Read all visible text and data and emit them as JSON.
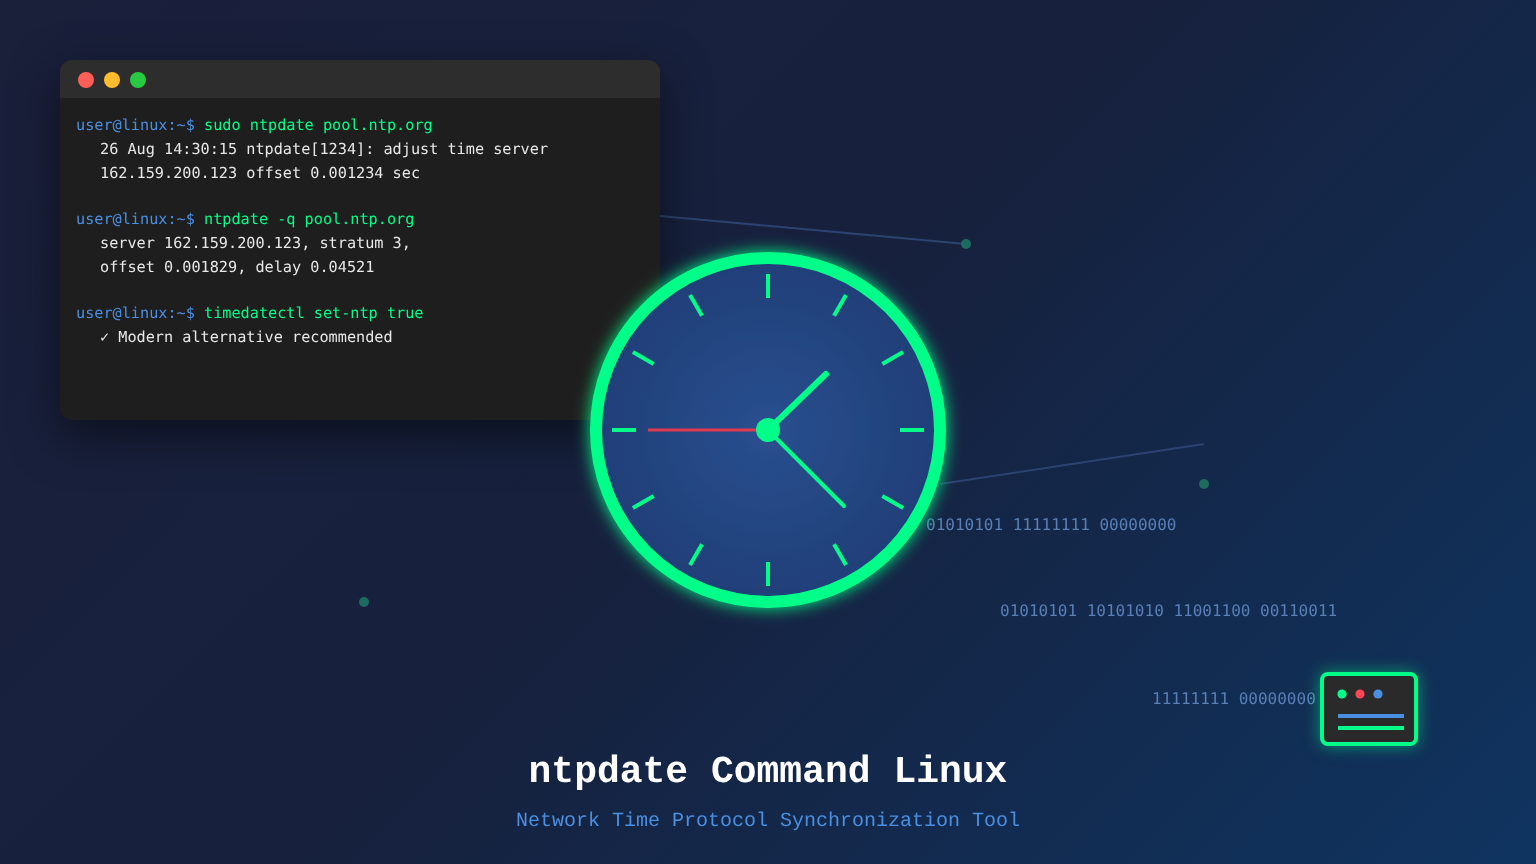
{
  "terminal": {
    "sessions": [
      {
        "prompt": "user@linux:~$",
        "command": "sudo ntpdate pool.ntp.org",
        "output": [
          "26 Aug 14:30:15 ntpdate[1234]: adjust time server",
          "162.159.200.123 offset 0.001234 sec"
        ]
      },
      {
        "prompt": "user@linux:~$",
        "command": "ntpdate -q pool.ntp.org",
        "output": [
          "server 162.159.200.123, stratum 3,",
          "offset 0.001829, delay 0.04521"
        ]
      },
      {
        "prompt": "user@linux:~$",
        "command": "timedatectl set-ntp true",
        "output": [
          "✓ Modern alternative recommended"
        ]
      }
    ]
  },
  "binary_texts": [
    "01010101 11111111 00000000",
    "01010101 10101010 11001100 00110011",
    "11111111 00000000"
  ],
  "title": "ntpdate Command Linux",
  "subtitle": "Network Time Protocol Synchronization Tool"
}
